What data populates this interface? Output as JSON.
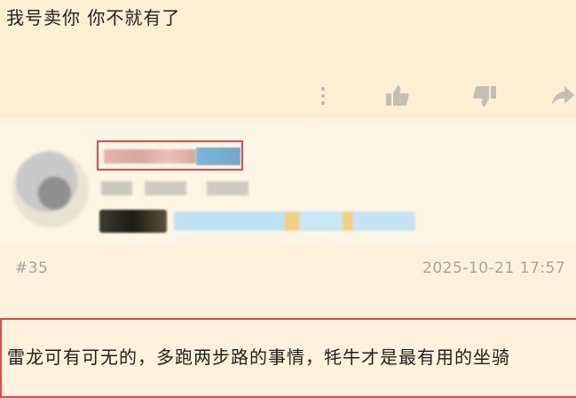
{
  "post": {
    "text": "我号卖你 你不就有了"
  },
  "icons": {
    "more": "more-vertical-icon",
    "like": "thumbs-up-icon",
    "dislike": "thumbs-down-icon",
    "share": "share-icon"
  },
  "reply": {
    "floor": "#35",
    "timestamp": "2025-10-21 17:57",
    "content": "雷龙可有可无的，多跑两步路的事情，牦牛才是最有用的坐骑"
  },
  "colors": {
    "background": "#fdf3dc",
    "highlight": "#e8484b",
    "meta_text": "#a9a49a"
  }
}
